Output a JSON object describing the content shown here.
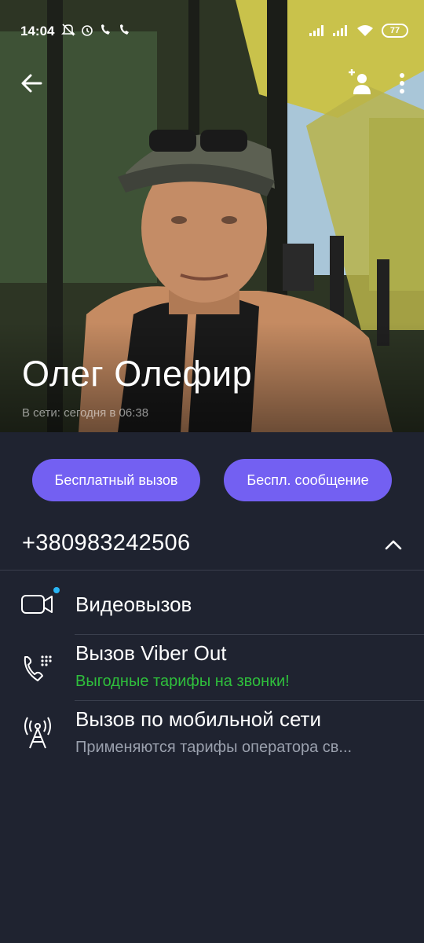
{
  "status_bar": {
    "time": "14:04",
    "left_icons": [
      "mute-icon",
      "alarm-icon",
      "wifi-call-icon",
      "wifi-call-icon"
    ],
    "battery": "77"
  },
  "header": {
    "name": "Олег Олефир",
    "last_seen": "В сети: сегодня в 06:38"
  },
  "actions": {
    "free_call": "Бесплатный вызов",
    "free_message": "Беспл. сообщение"
  },
  "phone": {
    "number": "+380983242506"
  },
  "options": [
    {
      "title": "Видеовызов",
      "subtitle": "",
      "icon": "video-camera-icon"
    },
    {
      "title": "Вызов Viber Out",
      "subtitle": "Выгодные тарифы на звонки!",
      "subtitle_color": "#2fbf3c",
      "icon": "viber-out-phone-icon"
    },
    {
      "title": "Вызов по мобильной сети",
      "subtitle": "Применяются тарифы оператора св...",
      "subtitle_color": "#9aa0ad",
      "icon": "cell-tower-icon"
    }
  ],
  "colors": {
    "accent": "#7360f2",
    "background": "#1f2330",
    "online_dot": "#29b6f6"
  }
}
